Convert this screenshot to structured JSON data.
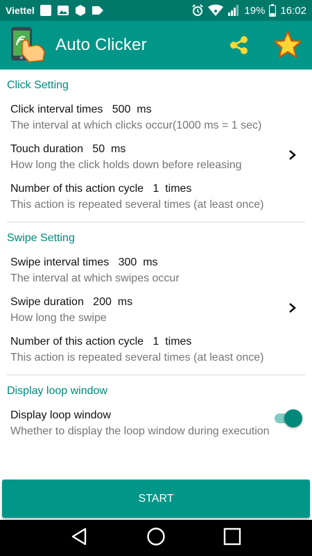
{
  "status_bar": {
    "carrier": "Viettel",
    "battery": "19%",
    "time": "16:02",
    "icons": [
      "notification-square-icon",
      "image-icon",
      "hexagon-icon",
      "tag-icon",
      "alarm-icon",
      "wifi-icon",
      "signal-icon",
      "battery-icon"
    ]
  },
  "app_bar": {
    "title": "Auto Clicker",
    "icons": [
      "app-logo-icon",
      "share-icon",
      "star-icon"
    ]
  },
  "click_setting": {
    "header": "Click Setting",
    "interval": {
      "title": "Click interval times   500  ms",
      "summary": "The interval at which clicks occur(1000 ms = 1 sec)"
    },
    "touch_duration": {
      "title": "Touch duration   50  ms",
      "summary": "How long the click holds down before releasing"
    },
    "cycle": {
      "title": "Number of this action cycle   1  times",
      "summary": "This action is repeated several times (at least once)"
    }
  },
  "swipe_setting": {
    "header": "Swipe Setting",
    "interval": {
      "title": "Swipe interval times   300  ms",
      "summary": "The interval at which swipes occur"
    },
    "duration": {
      "title": "Swipe duration   200  ms",
      "summary": "How long the swipe"
    },
    "cycle": {
      "title": "Number of this action cycle   1  times",
      "summary": "This action is repeated several times (at least once)"
    }
  },
  "display_loop": {
    "header": "Display loop window",
    "title": "Display loop window",
    "summary": "Whether to display the loop window during execution",
    "enabled": true
  },
  "start_button": {
    "label": "START"
  },
  "colors": {
    "primary": "#009688",
    "primary_dark": "#00796b",
    "accent_text": "#00897b"
  }
}
